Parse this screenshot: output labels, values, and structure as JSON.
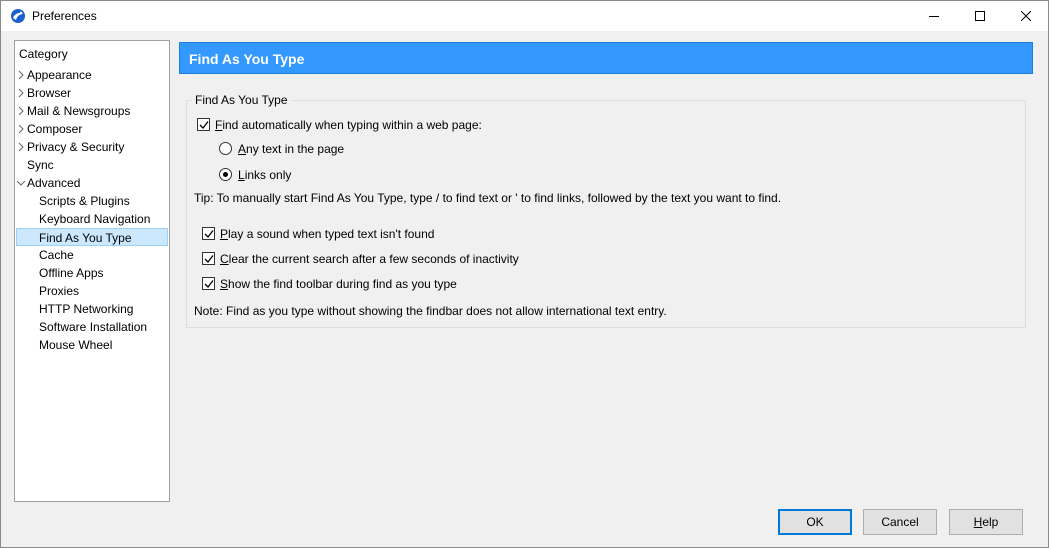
{
  "window": {
    "title": "Preferences"
  },
  "category": {
    "header": "Category",
    "items": [
      {
        "label": "Appearance"
      },
      {
        "label": "Browser"
      },
      {
        "label": "Mail & Newsgroups"
      },
      {
        "label": "Composer"
      },
      {
        "label": "Privacy & Security"
      },
      {
        "label": "Sync"
      },
      {
        "label": "Advanced"
      },
      {
        "label": "Scripts & Plugins"
      },
      {
        "label": "Keyboard Navigation"
      },
      {
        "label": "Find As You Type"
      },
      {
        "label": "Cache"
      },
      {
        "label": "Offline Apps"
      },
      {
        "label": "Proxies"
      },
      {
        "label": "HTTP Networking"
      },
      {
        "label": "Software Installation"
      },
      {
        "label": "Mouse Wheel"
      }
    ],
    "selected": "Find As You Type"
  },
  "panel": {
    "header": "Find As You Type",
    "group_title": "Find As You Type",
    "find_auto": {
      "first": "F",
      "rest": "ind automatically when typing within a web page:",
      "checked": true
    },
    "radio_any": {
      "first": "A",
      "rest": "ny text in the page",
      "selected": false
    },
    "radio_links": {
      "first": "L",
      "rest": "inks only",
      "selected": true
    },
    "tip": "Tip: To manually start Find As You Type, type / to find text or ' to find links, followed by the text you want to find.",
    "play_sound": {
      "first": "P",
      "rest": "lay a sound when typed text isn't found",
      "checked": true
    },
    "clear_search": {
      "first": "C",
      "rest": "lear the current search after a few seconds of inactivity",
      "checked": true
    },
    "show_toolbar": {
      "first": "S",
      "rest": "how the find toolbar during find as you type",
      "checked": true
    },
    "note": "Note: Find as you type without showing the findbar does not allow international text entry."
  },
  "buttons": {
    "ok": "OK",
    "cancel": "Cancel",
    "help_first": "H",
    "help_rest": "elp"
  },
  "colors": {
    "accent": "#3399ff",
    "selection": "#cce8ff"
  }
}
